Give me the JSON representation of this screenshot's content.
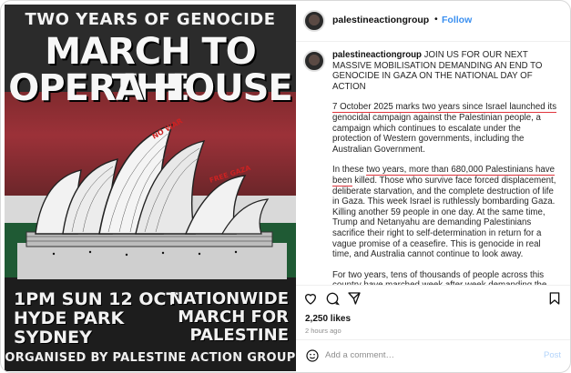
{
  "poster": {
    "top_line": "TWO YEARS OF GENOCIDE",
    "headline_line1": "MARCH TO THE",
    "headline_line2": "OPERA HOUSE",
    "graffiti_1": "NO WAR",
    "graffiti_2": "FREE GAZA",
    "left_line1": "1PM SUN 12 OCT",
    "left_line2": "HYDE PARK",
    "left_line3": "SYDNEY",
    "right_line1": "NATIONWIDE",
    "right_line2": "MARCH FOR",
    "right_line3": "PALESTINE",
    "footer": "ORGANISED BY PALESTINE ACTION GROUP",
    "colors": {
      "flag_red": "#a8323a",
      "flag_green": "#1f5a34",
      "flag_white": "#d9d9d9",
      "dark": "#1d1d1d"
    }
  },
  "header": {
    "username": "palestineactiongroup",
    "separator": "•",
    "follow_label": "Follow"
  },
  "caption": {
    "username": "palestineactiongroup",
    "intro": "JOIN US FOR OUR NEXT MASSIVE MOBILISATION DEMANDING AN END TO GENOCIDE IN GAZA ON THE NATIONAL DAY OF ACTION",
    "p2_underlined": "7 October 2025 marks two years since Israel launched its",
    "p2_rest": " genocidal campaign against the Palestinian people, a campaign which continues to escalate under the protection of Western governments, including the Australian Government.",
    "p3_lead": "In these ",
    "p3_underlined": "two years, more than 680,000 Palestinians have been",
    "p3_rest": " killed. Those who survive face forced displacement, deliberate starvation, and the complete destruction of life in Gaza. This week Israel is ruthlessly bombarding Gaza. Killing another 59 people in one day. At the same time, Trump and Netanyahu are demanding Palestinians sacrifice their right to self-determination in return for a vague promise of a ceasefire. This is genocide in real time, and Australia cannot continue to look away.",
    "p4": "For two years, tens of thousands of people across this country have marched week after week demanding the Albanese Government sanction Israel and end the two-way arms trade. Despite this, the government has failed to take any meaningful action to meet its obligations under international law to prevent and punish genocide.",
    "underline_color": "#e0353d"
  },
  "actions": {
    "icons": [
      "heart-icon",
      "comment-icon",
      "share-icon",
      "bookmark-icon"
    ],
    "likes": "2,250 likes",
    "time_ago": "2 hours ago"
  },
  "comment": {
    "placeholder": "Add a comment…",
    "post_label": "Post"
  },
  "accent_color": "#3a8ff0"
}
